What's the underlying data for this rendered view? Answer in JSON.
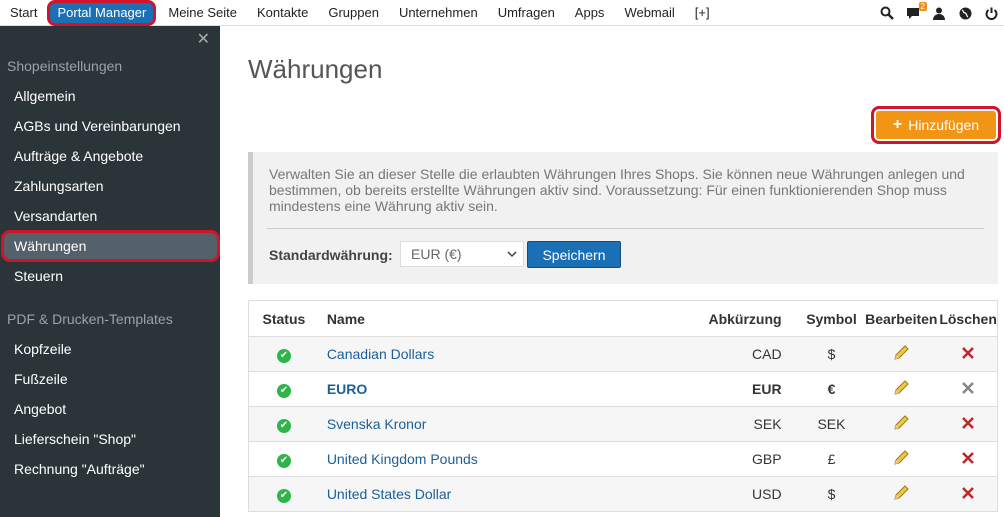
{
  "topnav": {
    "items": [
      "Start",
      "Portal Manager",
      "Meine Seite",
      "Kontakte",
      "Gruppen",
      "Unternehmen",
      "Umfragen",
      "Apps",
      "Webmail",
      "[+]"
    ],
    "badge_count": "2"
  },
  "sidebar": {
    "close_glyph": "✕",
    "section1": "Shopeinstellungen",
    "items1": [
      "Allgemein",
      "AGBs und Vereinbarungen",
      "Aufträge & Angebote",
      "Zahlungsarten",
      "Versandarten",
      "Währungen",
      "Steuern"
    ],
    "section2": "PDF & Drucken-Templates",
    "items2": [
      "Kopfzeile",
      "Fußzeile",
      "Angebot",
      "Lieferschein \"Shop\"",
      "Rechnung \"Aufträge\""
    ]
  },
  "main": {
    "title": "Währungen",
    "add_button": "Hinzufügen",
    "info": "Verwalten Sie an dieser Stelle die erlaubten Währungen Ihres Shops. Sie können neue Währungen anlegen und bestimmen, ob bereits erstellte Währungen aktiv sind. Voraussetzung: Für einen funktionierenden Shop muss mindestens eine Währung aktiv sein.",
    "default_label": "Standardwährung:",
    "default_value": "EUR (€)",
    "save_button": "Speichern"
  },
  "table": {
    "headers": [
      "Status",
      "Name",
      "Abkürzung",
      "Symbol",
      "Bearbeiten",
      "Löschen"
    ],
    "rows": [
      {
        "name": "Canadian Dollars",
        "abbr": "CAD",
        "symbol": "$"
      },
      {
        "name": "EURO",
        "abbr": "EUR",
        "symbol": "€"
      },
      {
        "name": "Svenska Kronor",
        "abbr": "SEK",
        "symbol": "SEK"
      },
      {
        "name": "United Kingdom Pounds",
        "abbr": "GBP",
        "symbol": "£"
      },
      {
        "name": "United States Dollar",
        "abbr": "USD",
        "symbol": "$"
      }
    ]
  },
  "colors": {
    "accent": "#1a6fb5",
    "sidebar_bg": "#2b3539",
    "orange": "#f29414",
    "highlight": "#d0142c",
    "ok_green": "#2eb54a",
    "delete_red": "#c0272d"
  }
}
